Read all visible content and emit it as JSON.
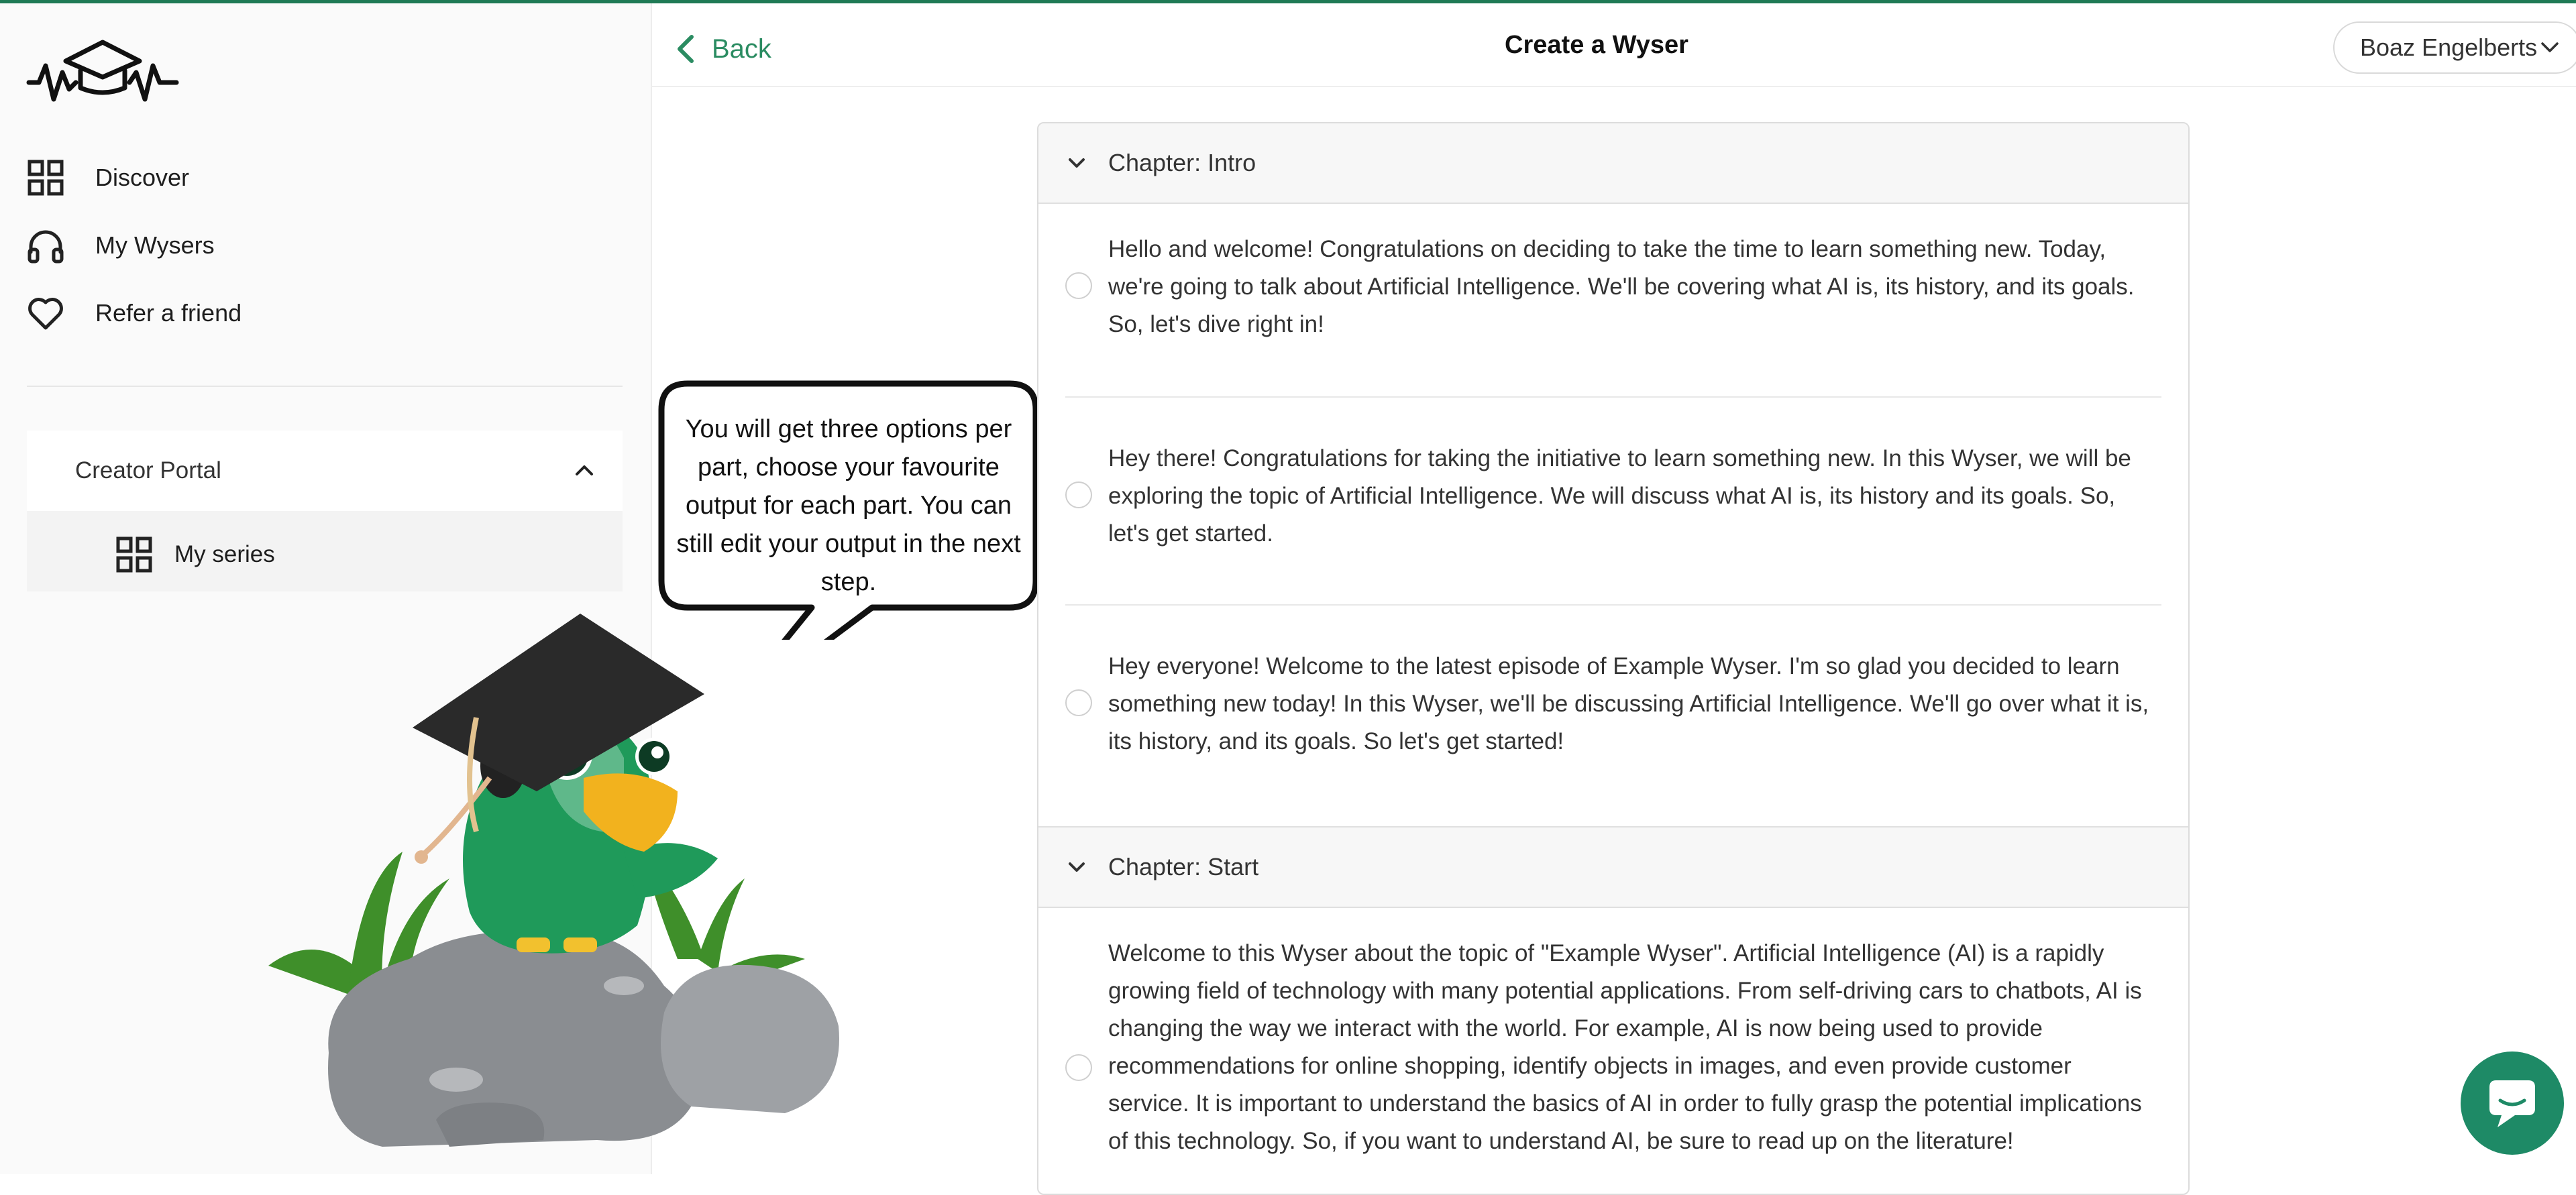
{
  "colors": {
    "accent": "#2b8c62",
    "brand": "#1f7a55",
    "chat_button": "#1e8a66"
  },
  "sidebar": {
    "logo_icon": "wyser-logo-icon",
    "items": [
      {
        "label": "Discover",
        "icon": "grid-icon"
      },
      {
        "label": "My Wysers",
        "icon": "headphones-icon"
      },
      {
        "label": "Refer a friend",
        "icon": "heart-icon"
      }
    ],
    "creator_portal": {
      "label": "Creator Portal",
      "icon": "chevron-up-icon",
      "items": [
        {
          "label": "My series",
          "icon": "grid-icon"
        }
      ]
    },
    "tip_bubble": "You will get three options per part, choose your favourite output for each part. You can still edit your output in the next step."
  },
  "header": {
    "back_label": "Back",
    "title": "Create a Wyser",
    "user_name": "Boaz Engelberts"
  },
  "chapters": [
    {
      "label": "Chapter: Intro",
      "options": [
        "Hello and welcome! Congratulations on deciding to take the time to learn something new. Today, we're going to talk about Artificial Intelligence. We'll be covering what AI is, its history, and its goals. So, let's dive right in!",
        "Hey there! Congratulations for taking the initiative to learn something new. In this Wyser, we will be exploring the topic of Artificial Intelligence. We will discuss what AI is, its history and its goals. So, let's get started.",
        "Hey everyone! Welcome to the latest episode of Example Wyser. I'm so glad you decided to learn something new today! In this Wyser, we'll be discussing Artificial Intelligence. We'll go over what it is, its history, and its goals. So let's get started!"
      ]
    },
    {
      "label": "Chapter: Start",
      "options": [
        "Welcome to this Wyser about the topic of \"Example Wyser\". Artificial Intelligence (AI) is a rapidly growing field of technology with many potential applications. From self-driving cars to chatbots, AI is changing the way we interact with the world. For example, AI is now being used to provide recommendations for online shopping, identify objects in images, and even provide customer service. It is important to understand the basics of AI in order to fully grasp the potential implications of this technology. So, if you want to understand AI, be sure to read up on the literature!"
      ]
    }
  ]
}
